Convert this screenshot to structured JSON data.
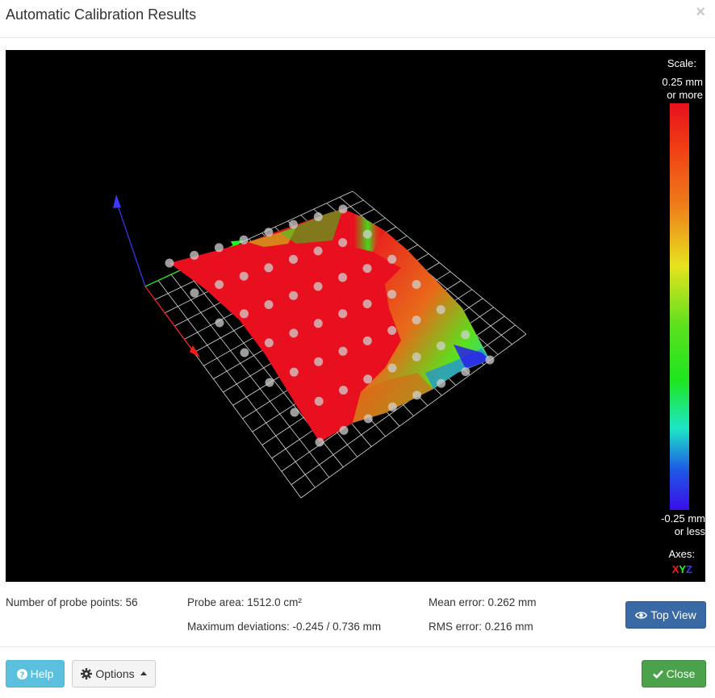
{
  "dialog": {
    "title": "Automatic Calibration Results",
    "close_glyph": "×"
  },
  "legend": {
    "title": "Scale:",
    "max_line1": "0.25 mm",
    "max_line2": "or more",
    "min_line1": "-0.25 mm",
    "min_line2": "or less",
    "axes_title": "Axes:",
    "axis_x": "X",
    "axis_y": "Y",
    "axis_z": "Z",
    "colors": {
      "max": "#e8101e",
      "mid": "#1ee61e",
      "min": "#3a0ee8",
      "axis_x": "#ff1a1a",
      "axis_y": "#1aff1a",
      "axis_z": "#3a3aff"
    }
  },
  "stats": {
    "probe_points": "Number of probe points: 56",
    "probe_area": "Probe area: 1512.0 cm²",
    "max_deviations": "Maximum deviations: -0.245 / 0.736 mm",
    "mean_error": "Mean error: 0.262 mm",
    "rms_error": "RMS error: 0.216 mm"
  },
  "buttons": {
    "top_view": "Top View",
    "help": "Help",
    "options": "Options",
    "close": "Close"
  },
  "icons": {
    "top_view": "eye-icon",
    "help": "question-circle-icon",
    "options": "gear-icon",
    "close": "check-icon"
  }
}
